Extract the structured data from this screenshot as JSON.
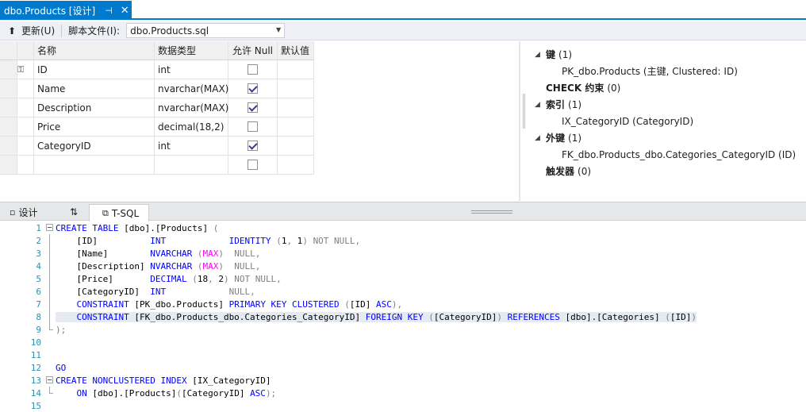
{
  "tab": {
    "title": "dbo.Products [设计]",
    "pin_icon": "pin-icon",
    "close_icon": "close-icon"
  },
  "toolbar": {
    "update_label": "更新(U)",
    "script_file_label": "脚本文件(I):",
    "script_file_value": "dbo.Products.sql"
  },
  "grid": {
    "headers": {
      "name": "名称",
      "type": "数据类型",
      "allow_null": "允许 Null",
      "default": "默认值"
    },
    "rows": [
      {
        "name": "ID",
        "type": "int",
        "allow_null": false,
        "key": true
      },
      {
        "name": "Name",
        "type": "nvarchar(MAX)",
        "allow_null": true,
        "key": false
      },
      {
        "name": "Description",
        "type": "nvarchar(MAX)",
        "allow_null": true,
        "key": false
      },
      {
        "name": "Price",
        "type": "decimal(18,2)",
        "allow_null": false,
        "key": false
      },
      {
        "name": "CategoryID",
        "type": "int",
        "allow_null": true,
        "key": false
      },
      {
        "name": "",
        "type": "",
        "allow_null": false,
        "key": false
      }
    ]
  },
  "properties": {
    "keys": {
      "label": "键",
      "count": "(1)",
      "item": "PK_dbo.Products   (主键, Clustered: ID)"
    },
    "check": {
      "label": "CHECK 约束",
      "count": "(0)"
    },
    "indexes": {
      "label": "索引",
      "count": "(1)",
      "item": "IX_CategoryID   (CategoryID)"
    },
    "foreign_keys": {
      "label": "外键",
      "count": "(1)",
      "item": "FK_dbo.Products_dbo.Categories_CategoryID   (ID)"
    },
    "triggers": {
      "label": "触发器",
      "count": "(0)"
    }
  },
  "pane_tabs": {
    "design": "设计",
    "swap": "⇅",
    "tsql": "T-SQL"
  },
  "code": {
    "line_numbers": [
      "1",
      "2",
      "3",
      "4",
      "5",
      "6",
      "7",
      "8",
      "9",
      "10",
      "11",
      "12",
      "13",
      "14",
      "15"
    ]
  },
  "colors": {
    "accent": "#007acc",
    "keyword": "#0000ff",
    "function": "#ff00ff",
    "operator": "#808080",
    "line_number": "#2b91af"
  }
}
